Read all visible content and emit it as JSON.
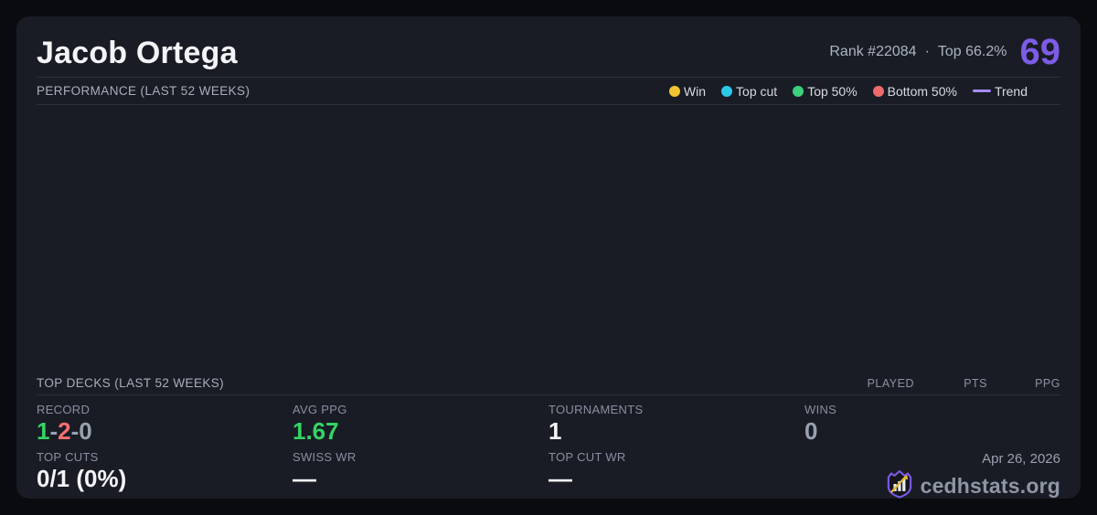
{
  "header": {
    "player_name": "Jacob Ortega",
    "rank_text": "Rank #22084",
    "separator": "·",
    "top_percent": "Top 66.2%",
    "score": "69",
    "score_color": "#7d5ce6"
  },
  "performance": {
    "title": "PERFORMANCE (LAST 52 WEEKS)",
    "legend": [
      {
        "label": "Win",
        "color": "#f1c232",
        "type": "dot",
        "icon": "win-dot-icon"
      },
      {
        "label": "Top cut",
        "color": "#2bc8e8",
        "type": "dot",
        "icon": "top-cut-dot-icon"
      },
      {
        "label": "Top 50%",
        "color": "#3bcf7d",
        "type": "dot",
        "icon": "top-50-dot-icon"
      },
      {
        "label": "Bottom 50%",
        "color": "#ef6b6b",
        "type": "dot",
        "icon": "bottom-50-dot-icon"
      },
      {
        "label": "Trend",
        "color": "#a78bfa",
        "type": "line",
        "icon": "trend-line-icon"
      }
    ]
  },
  "top_decks": {
    "title": "TOP DECKS (LAST 52 WEEKS)",
    "columns": [
      "PLAYED",
      "PTS",
      "PPG"
    ],
    "rows": []
  },
  "stats": {
    "record": {
      "label": "RECORD",
      "wins": "1",
      "losses": "2",
      "draws": "0",
      "dash": "-"
    },
    "avg_ppg": {
      "label": "AVG PPG",
      "value": "1.67"
    },
    "tournaments": {
      "label": "TOURNAMENTS",
      "value": "1"
    },
    "wins": {
      "label": "WINS",
      "value": "0"
    },
    "top_cuts": {
      "label": "TOP CUTS",
      "value": "0/1 (0%)"
    },
    "swiss_wr": {
      "label": "SWISS WR",
      "value": "—"
    },
    "top_cut_wr": {
      "label": "TOP CUT WR",
      "value": "—"
    }
  },
  "footer": {
    "date": "Apr 26, 2026",
    "brand": "cedhstats.org"
  },
  "colors": {
    "card_bg": "#191c25",
    "page_bg": "#0a0b0f",
    "accent_purple": "#7d5ce6",
    "green": "#34d465",
    "red": "#f37070",
    "gold": "#e8b931"
  }
}
